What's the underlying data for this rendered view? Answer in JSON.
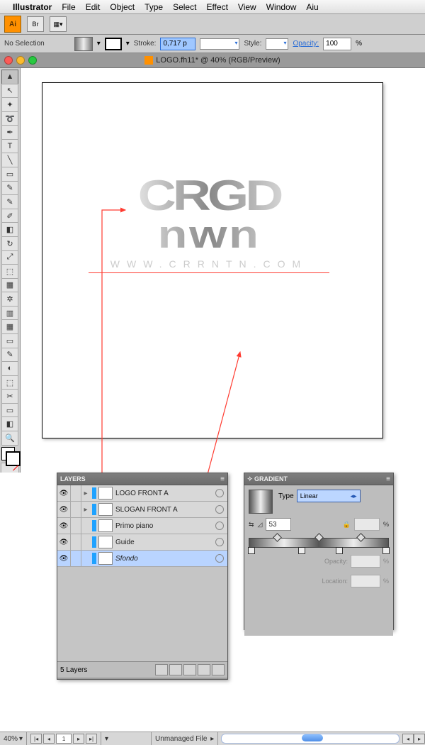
{
  "menubar": {
    "app": "Illustrator",
    "items": [
      "File",
      "Edit",
      "Object",
      "Type",
      "Select",
      "Effect",
      "View",
      "Window",
      "Aiu"
    ]
  },
  "toolbar1": {
    "ai": "Ai",
    "preview_btn": "Br",
    "doc_btn": "▦"
  },
  "control": {
    "selection": "No Selection",
    "stroke_label": "Stroke:",
    "stroke_val": "0,717 p",
    "style_label": "Style:",
    "opacity_label": "Opacity:",
    "opacity_val": "100",
    "opacity_unit": "%"
  },
  "doc": {
    "title": "LOGO.fh11* @ 40% (RGB/Preview)"
  },
  "artwork": {
    "line1": "CRGD",
    "line2": "nwn",
    "url": "WWW.CRRNTN.COM"
  },
  "layers_panel": {
    "title": "LAYERS",
    "rows": [
      {
        "name": "LOGO FRONT A",
        "italic": false
      },
      {
        "name": "SLOGAN FRONT A",
        "italic": false
      },
      {
        "name": "Primo piano",
        "italic": false
      },
      {
        "name": "Guide",
        "italic": false
      },
      {
        "name": "Sfondo",
        "italic": true,
        "selected": true
      }
    ],
    "footer": "5 Layers"
  },
  "gradient_panel": {
    "title": "GRADIENT",
    "type_label": "Type",
    "type_value": "Linear",
    "angle_val": "53",
    "lock": "🔒",
    "opacity_label": "Opacity:",
    "location_label": "Location:",
    "pct": "%"
  },
  "status": {
    "zoom": "40%",
    "page": "1",
    "colormode": "",
    "file_status": "Unmanaged File"
  },
  "tools": [
    "▲",
    "↖",
    "✦",
    "✒",
    "T",
    "╲",
    "▭",
    "✎",
    "⌀",
    "↻",
    "▦",
    "⬚",
    "▤",
    "◧",
    "▭",
    "▭",
    "◐",
    "⬚",
    "◧",
    "⬚",
    "✋",
    "🔍",
    "◧"
  ]
}
